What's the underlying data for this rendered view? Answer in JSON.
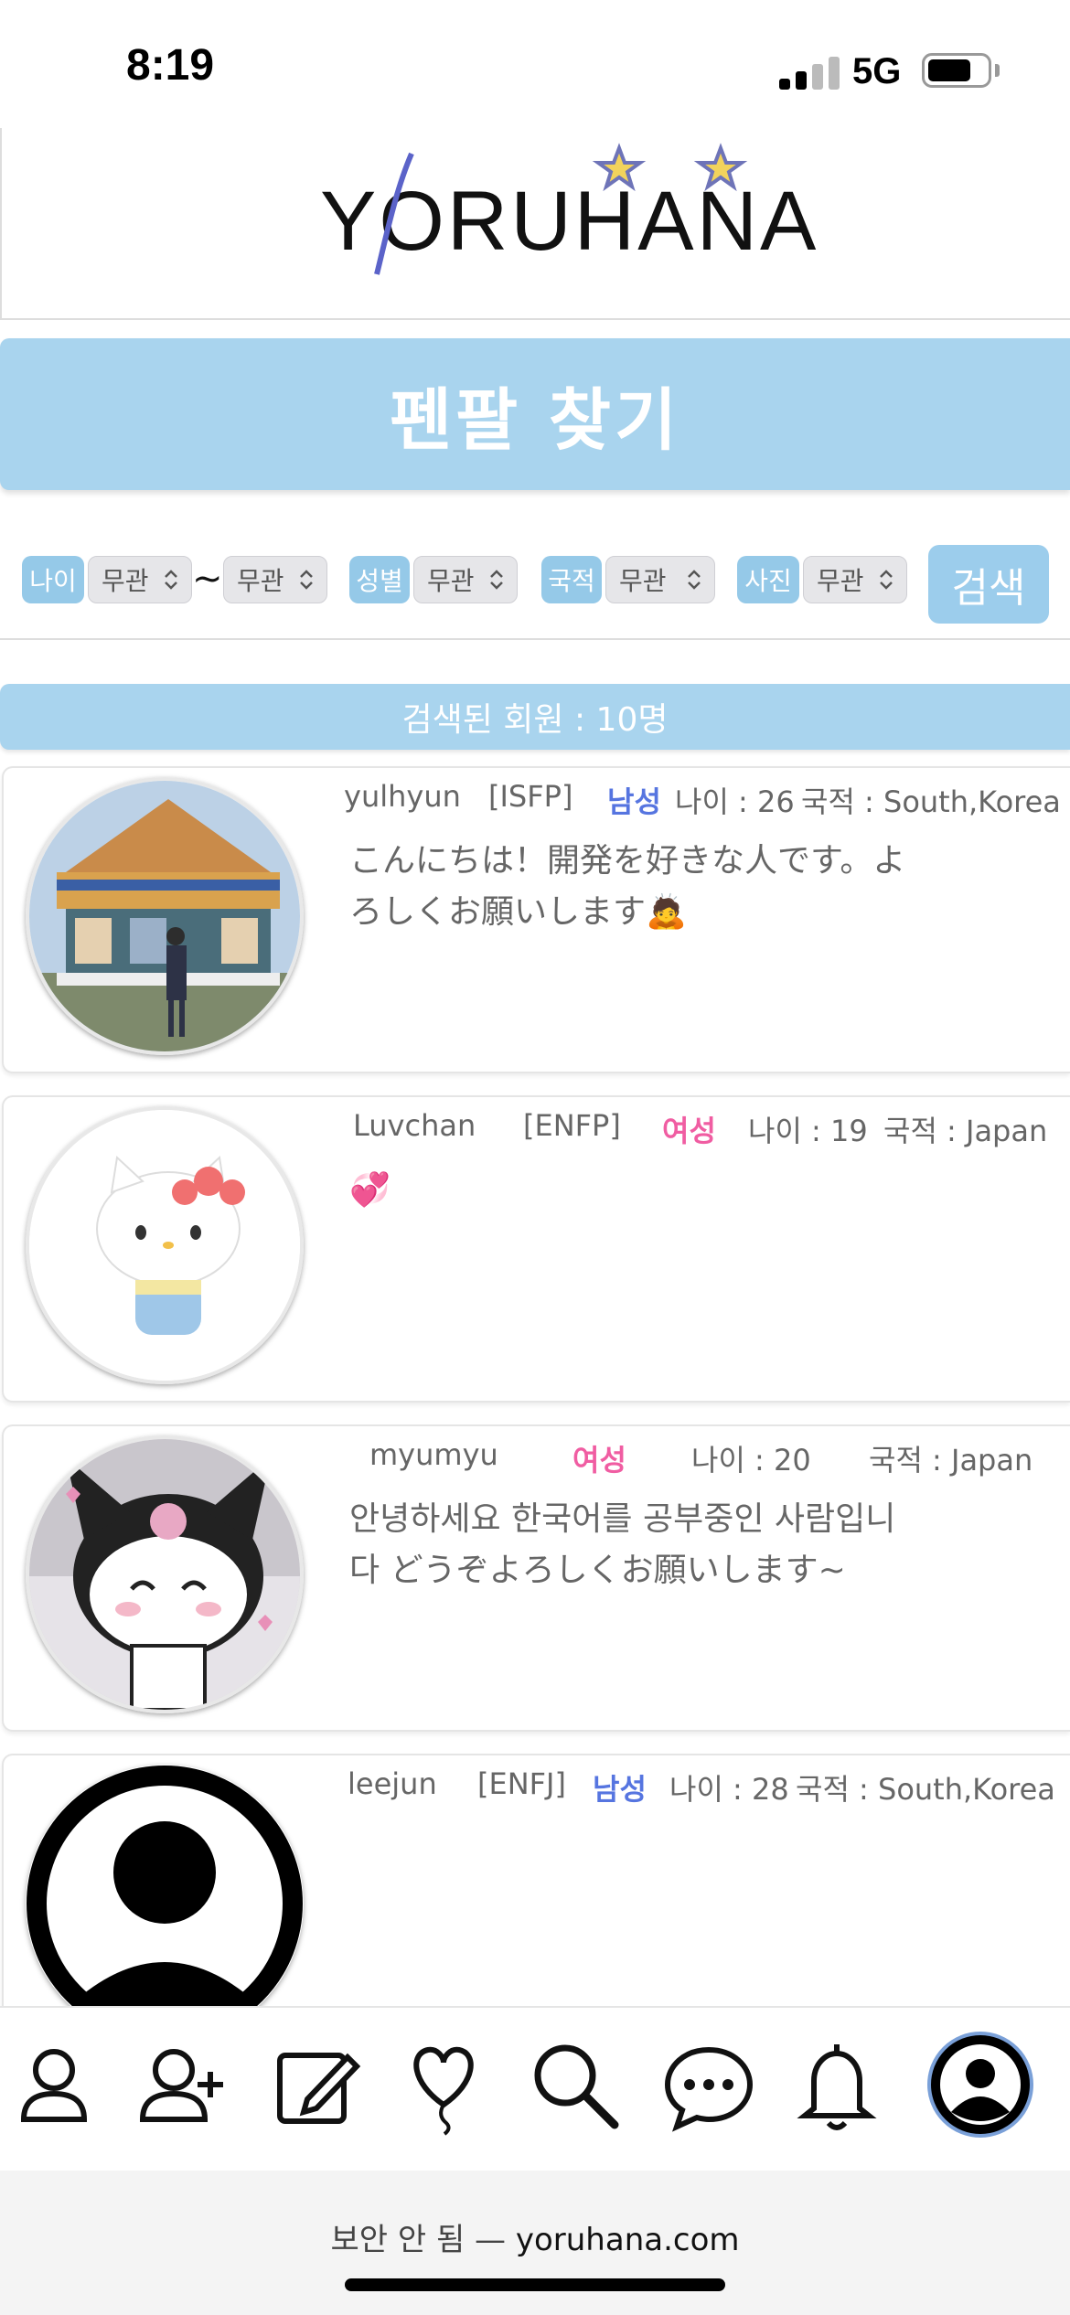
{
  "status_bar": {
    "time": "8:19",
    "network": "5G",
    "battery_percent": 75
  },
  "header": {
    "logo": "YORUHANA"
  },
  "page": {
    "title": "펜팔 찾기"
  },
  "filters": {
    "age_label": "나이",
    "age_min": "무관",
    "age_sep": "~",
    "age_max": "무관",
    "gender_label": "성별",
    "gender_value": "무관",
    "country_label": "국적",
    "country_value": "무관",
    "photo_label": "사진",
    "photo_value": "무관",
    "search_button": "검색"
  },
  "results": {
    "summary": "검색된 회원 : 10명"
  },
  "members": [
    {
      "username": "yulhyun",
      "mbti": "[ISFP]",
      "gender": "남성",
      "age": "나이 : 26",
      "country": "국적 : South,Korea",
      "bio": "こんにちは！開発を好きな人です。よろしくお願いします🙇",
      "avatar_icon": "carousel-photo"
    },
    {
      "username": "Luvchan",
      "mbti": "[ENFP]",
      "gender": "여성",
      "age": "나이 : 19",
      "country": "국적 : Japan",
      "bio": "💞",
      "avatar_icon": "hello-kitty-figure"
    },
    {
      "username": "myumyu",
      "mbti": "",
      "gender": "여성",
      "age": "나이 : 20",
      "country": "국적 : Japan",
      "bio": "안녕하세요 한국어를 공부중인 사람입니다 どうぞよろしくお願いします~",
      "avatar_icon": "kuromi-character"
    },
    {
      "username": "leejun",
      "mbti": "[ENFJ]",
      "gender": "남성",
      "age": "나이 : 28",
      "country": "국적 : South,Korea",
      "bio": "",
      "avatar_icon": "default-person-avatar"
    }
  ],
  "tabbar": {
    "items": [
      "profile-icon",
      "add-friend-icon",
      "write-icon",
      "heart-balloon-icon",
      "search-icon",
      "chat-icon",
      "bell-icon",
      "my-account-icon"
    ]
  },
  "browser": {
    "security": "보안 안 됨 —",
    "domain": "yoruhana.com"
  },
  "colors": {
    "accent": "#a9d4ee",
    "male": "#5675e0",
    "female": "#f05da2"
  }
}
